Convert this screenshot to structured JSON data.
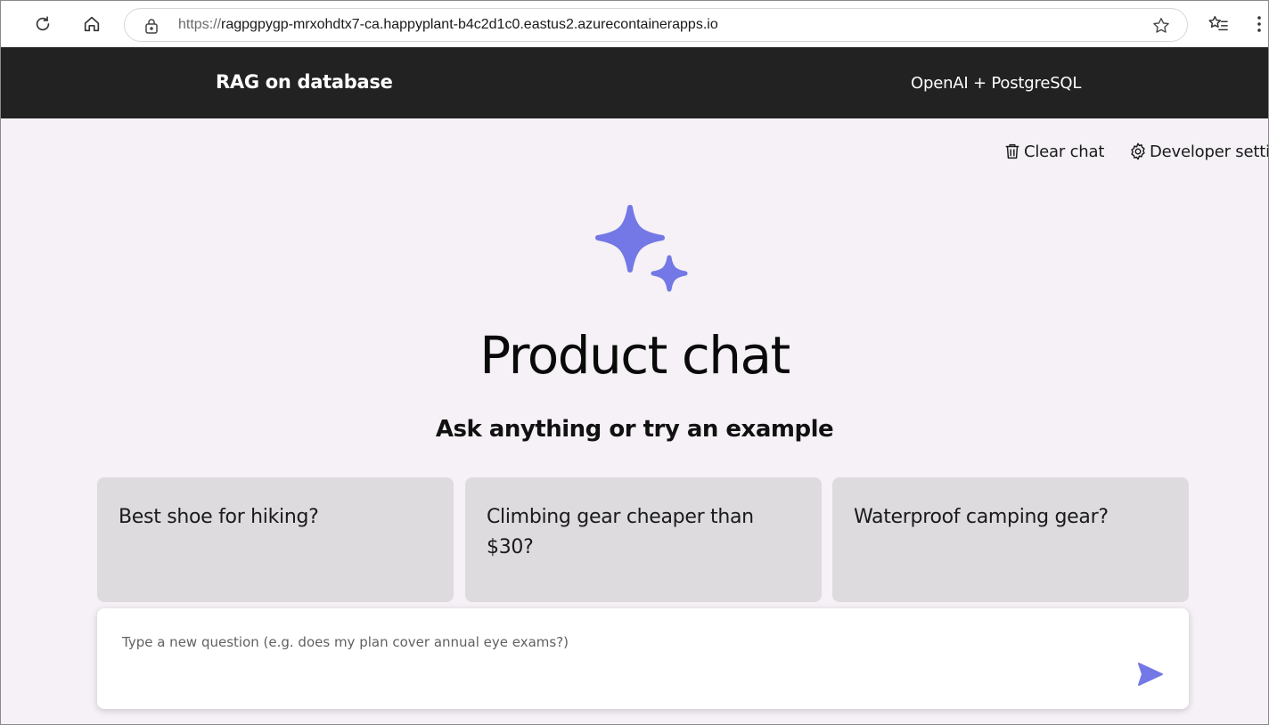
{
  "browser": {
    "url_scheme": "https://",
    "url_host": "ragpgpygp-mrxohdtx7-ca.happyplant-b4c2d1c0.eastus2.azurecontainerapps.io",
    "icons": [
      "refresh-icon",
      "home-icon",
      "lock-icon",
      "star-icon",
      "favorites-icon",
      "more-icon"
    ]
  },
  "header": {
    "title": "RAG on database",
    "subtitle": "OpenAI + PostgreSQL"
  },
  "commands": {
    "clear_chat": "Clear chat",
    "developer_settings": "Developer setti"
  },
  "main": {
    "title": "Product chat",
    "subtitle": "Ask anything or try an example",
    "examples": [
      "Best shoe for hiking?",
      "Climbing gear cheaper than $30?",
      "Waterproof camping gear?"
    ]
  },
  "question": {
    "placeholder": "Type a new question (e.g. does my plan cover annual eye exams?)",
    "value": ""
  },
  "colors": {
    "accent": "#7378e6",
    "header_bg": "#222222",
    "page_bg": "#f5f1f6",
    "card_bg": "#dddbde"
  }
}
